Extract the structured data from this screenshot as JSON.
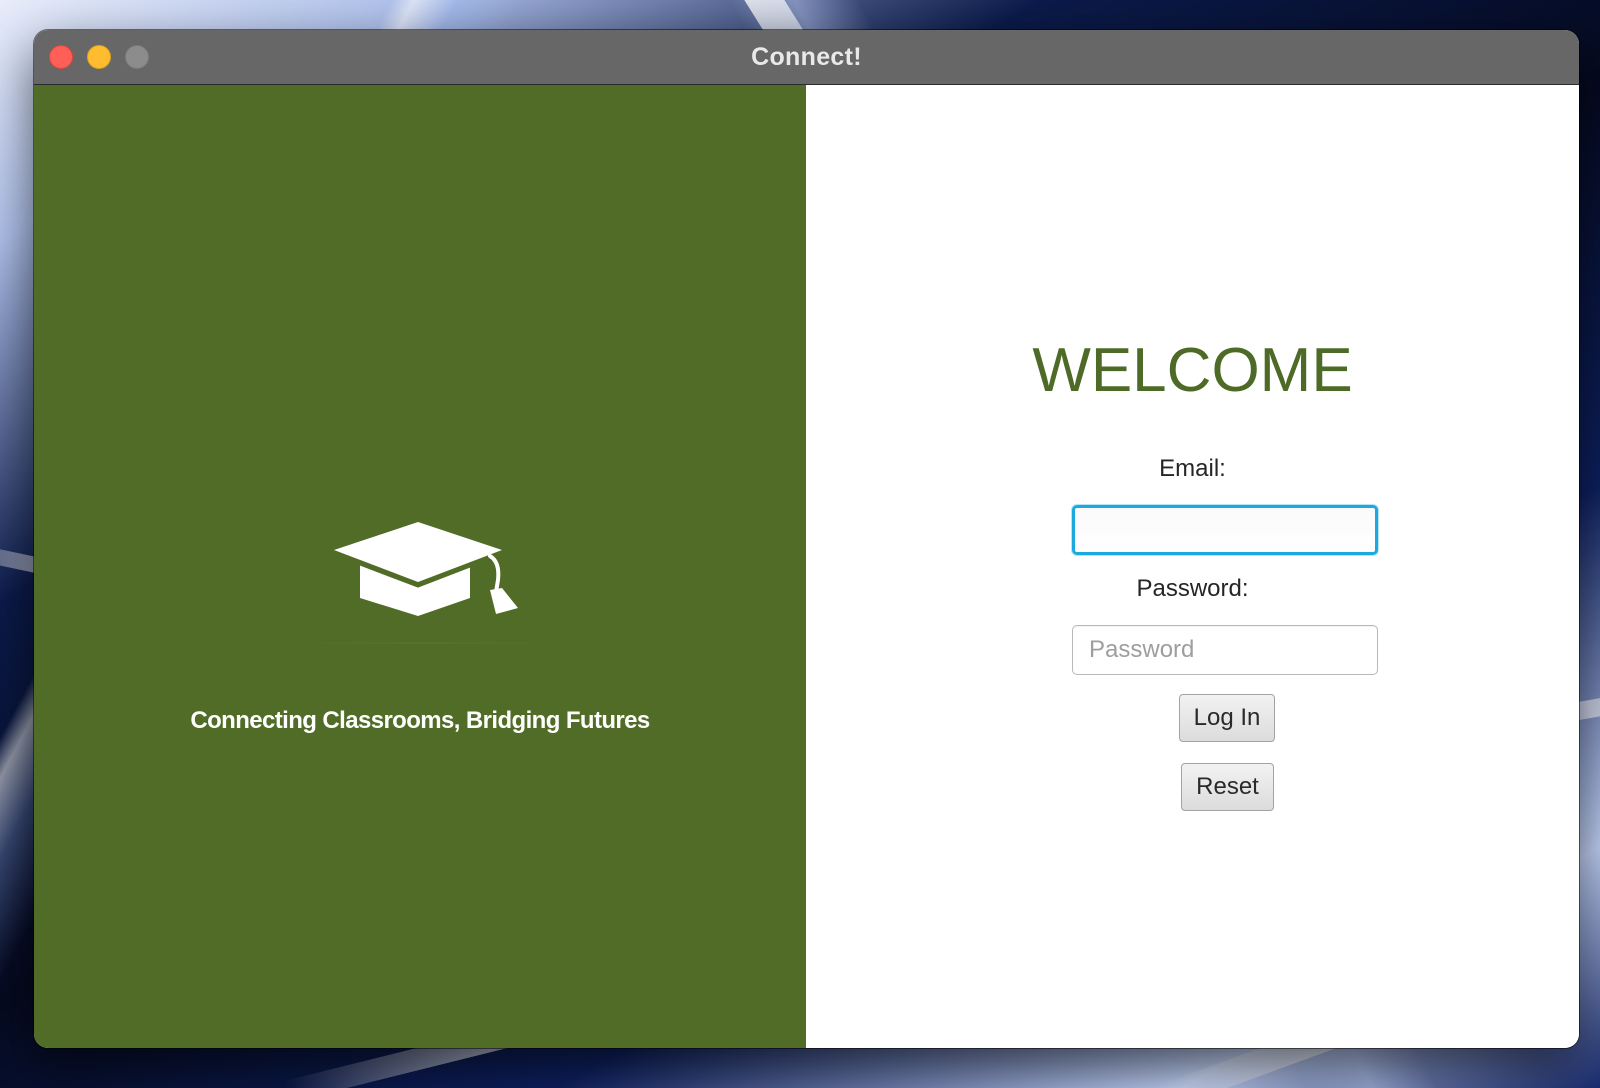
{
  "window": {
    "title": "Connect!",
    "controls": [
      "close",
      "minimize",
      "zoom"
    ]
  },
  "left_panel": {
    "background_color": "#506c26",
    "logo_icon": "graduation-cap-icon",
    "tagline": "Connecting Classrooms, Bridging Futures"
  },
  "login": {
    "heading": "WELCOME",
    "heading_color": "#4d6b26",
    "email_label": "Email:",
    "email_value": "",
    "email_placeholder": "",
    "password_label": "Password:",
    "password_value": "",
    "password_placeholder": "Password",
    "login_button": "Log In",
    "reset_button": "Reset",
    "focus_color": "#1ba9e0"
  }
}
